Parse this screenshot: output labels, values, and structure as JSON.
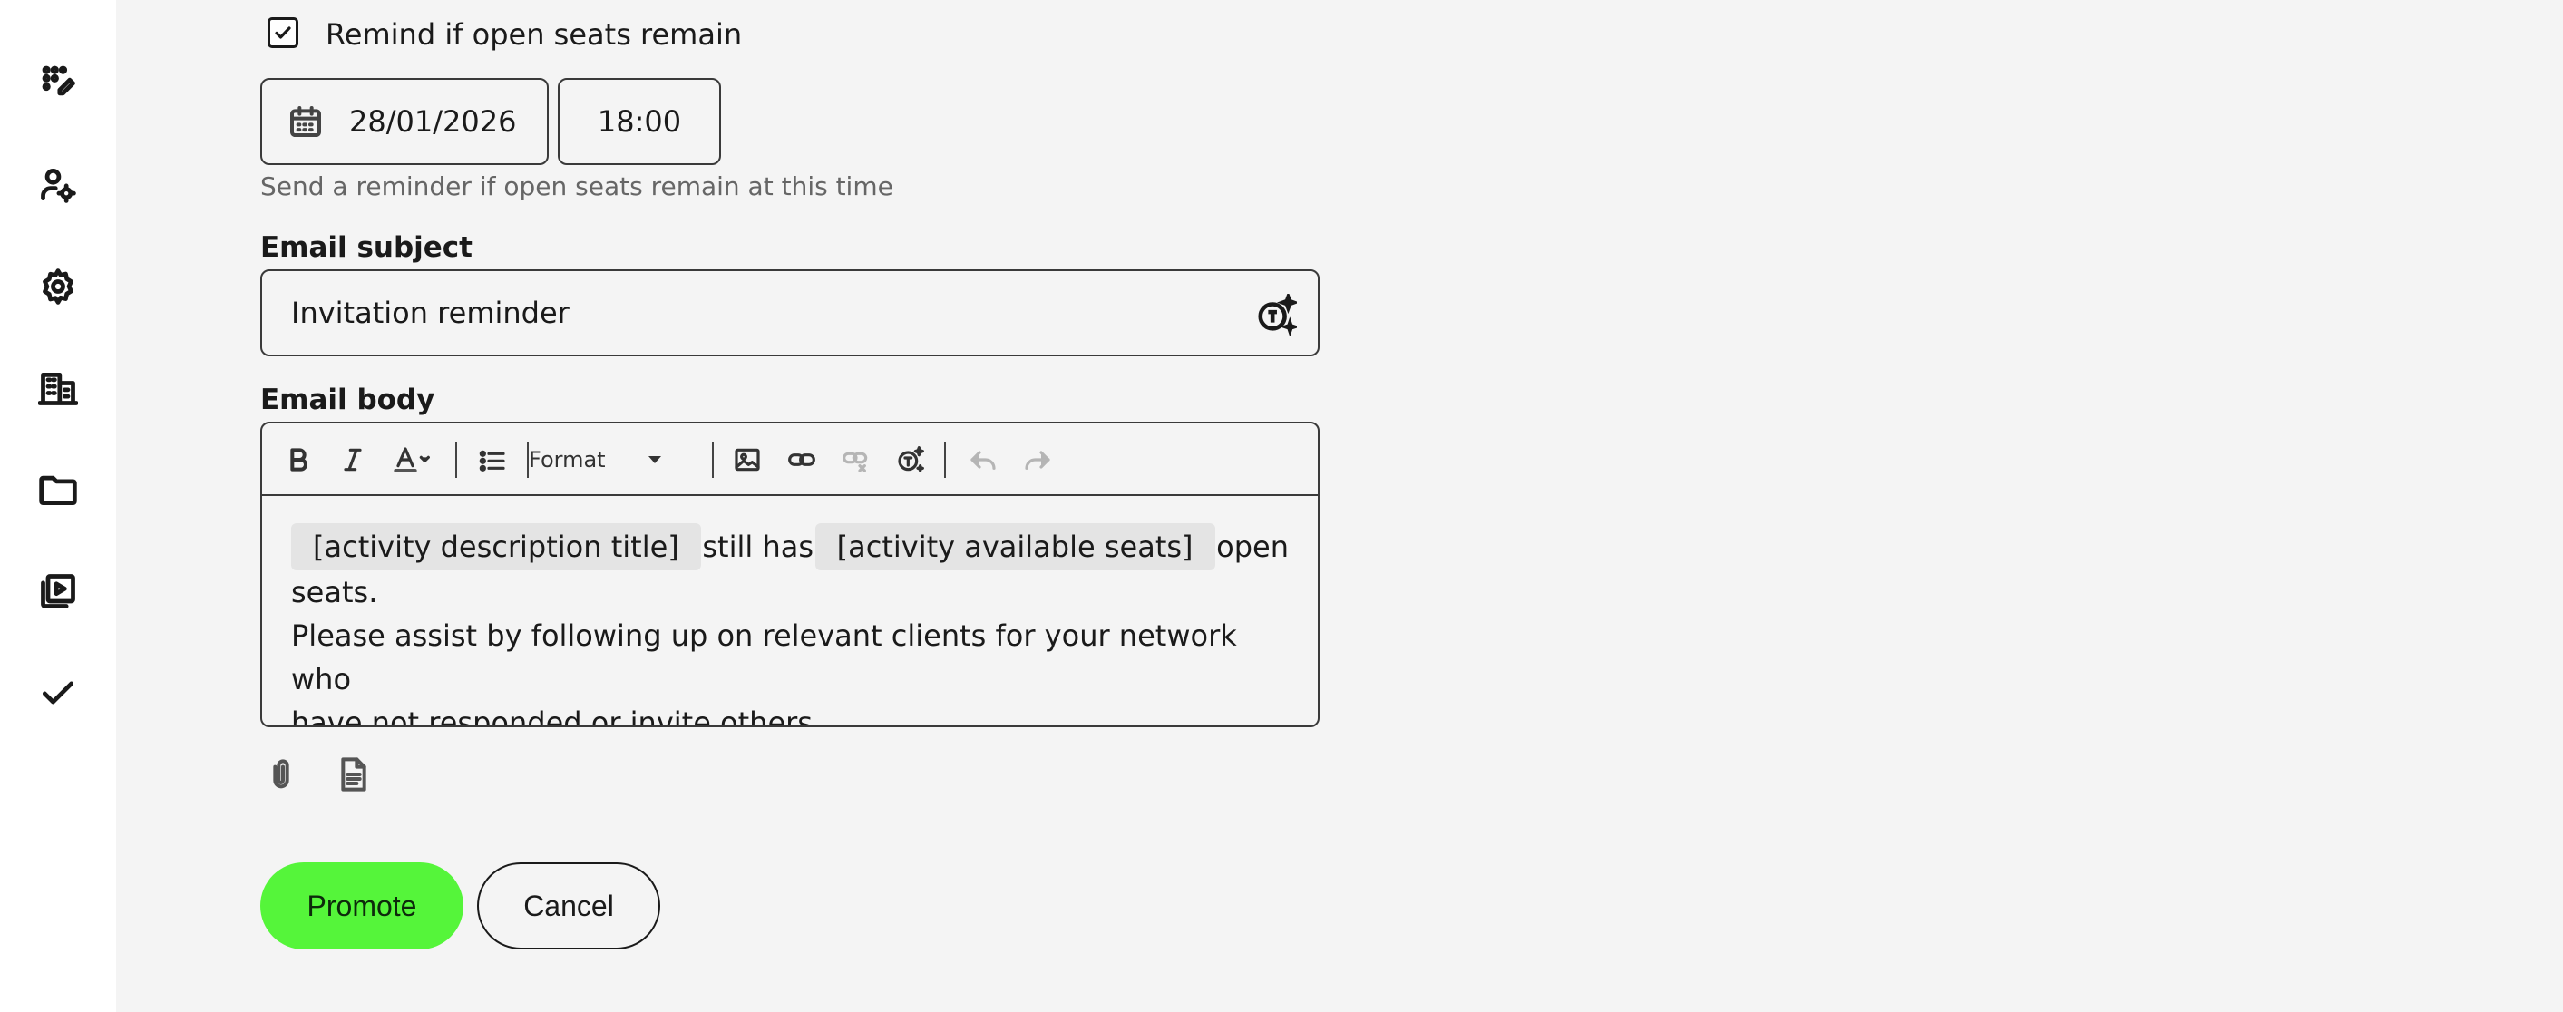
{
  "sidebar": {
    "items": [
      {
        "icon": "dial-pad-edit-icon"
      },
      {
        "icon": "user-settings-icon"
      },
      {
        "icon": "gear-icon"
      },
      {
        "icon": "building-icon"
      },
      {
        "icon": "folder-icon"
      },
      {
        "icon": "video-library-icon"
      },
      {
        "icon": "checkmark-icon"
      }
    ]
  },
  "reminder": {
    "checkbox_label": "Remind if open seats remain",
    "checked": true,
    "date": "28/01/2026",
    "time": "18:00",
    "hint": "Send a reminder if open seats remain at this time"
  },
  "email": {
    "subject_label": "Email subject",
    "subject_value": "Invitation reminder",
    "body_label": "Email body",
    "toolbar": {
      "format_label": "Format"
    },
    "body": {
      "chip1": "[activity description title]",
      "text1": "still has",
      "chip2": "[activity available seats]",
      "text2": "open",
      "text3": "seats.",
      "text4": "Please assist by following up on relevant clients for your network who",
      "text5": "have not responded or invite others."
    }
  },
  "actions": {
    "promote_label": "Promote",
    "cancel_label": "Cancel"
  },
  "colors": {
    "accent": "#55f53a",
    "background": "#f4f4f4",
    "sidebar": "#ffffff"
  }
}
